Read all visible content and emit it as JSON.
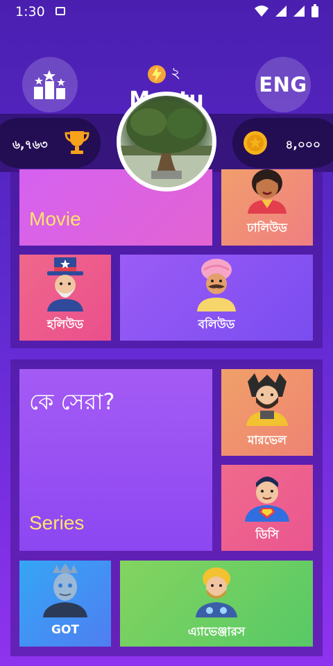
{
  "status": {
    "time": "1:30"
  },
  "header": {
    "energy_count": "২",
    "username": "Montu",
    "lang_label": "ENG"
  },
  "stats": {
    "trophies": "৬,৭৬৩",
    "coins": "৪,০০০"
  },
  "section1": {
    "movie_label": "Movie",
    "tiles": [
      {
        "label": "ঢালিউড"
      },
      {
        "label": "হলিউড"
      },
      {
        "label": "বলিউড"
      }
    ]
  },
  "section2": {
    "title": "কে সেরা?",
    "series_label": "Series",
    "tiles": [
      {
        "label": "মারভেল"
      },
      {
        "label": "ডিসি"
      },
      {
        "label": "GOT"
      },
      {
        "label": "এ্যাভেঞ্জারস"
      }
    ]
  },
  "colors": {
    "accent": "#ffe36b",
    "bg_top": "#4a1fb0",
    "bg_bottom": "#8f33ef"
  }
}
